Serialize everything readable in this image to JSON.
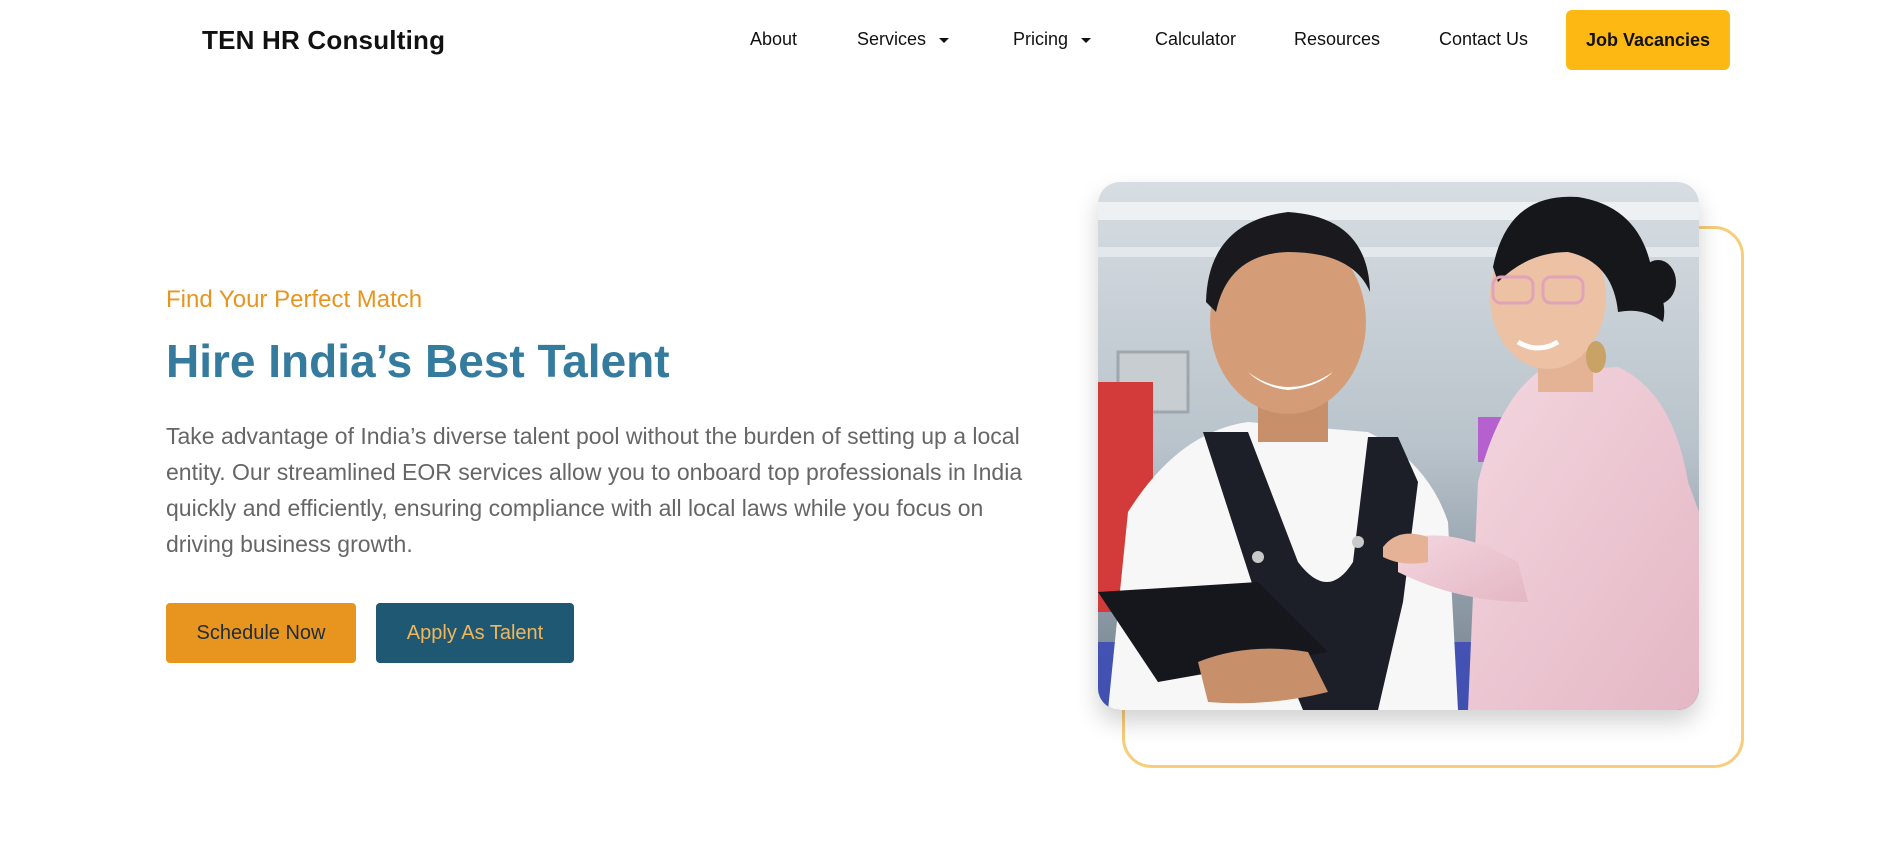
{
  "header": {
    "brand": "TEN HR Consulting",
    "nav": [
      {
        "label": "About",
        "has_dropdown": false
      },
      {
        "label": "Services",
        "has_dropdown": true
      },
      {
        "label": "Pricing",
        "has_dropdown": true
      },
      {
        "label": "Calculator",
        "has_dropdown": false
      },
      {
        "label": "Resources",
        "has_dropdown": false
      },
      {
        "label": "Contact Us",
        "has_dropdown": false
      }
    ],
    "cta_label": "Job Vacancies"
  },
  "hero": {
    "eyebrow": "Find Your Perfect Match",
    "title": "Hire India’s Best Talent",
    "description": "Take advantage of India’s diverse talent pool without the burden of setting up a local entity. Our streamlined EOR services allow you to onboard top professionals in India quickly and efficiently, ensuring compliance with all local laws while you focus on driving business growth.",
    "primary_button": "Schedule Now",
    "secondary_button": "Apply As Talent",
    "image": "photo-two-workers-reviewing-clipboard"
  },
  "colors": {
    "brand_yellow": "#fdb813",
    "accent_orange": "#e8951f",
    "title_blue": "#347b9e",
    "button_navy": "#1f5873",
    "frame_outline": "#f7cd7a",
    "body_gray": "#666666"
  },
  "icons": {
    "dropdown": "caret-down-icon"
  }
}
